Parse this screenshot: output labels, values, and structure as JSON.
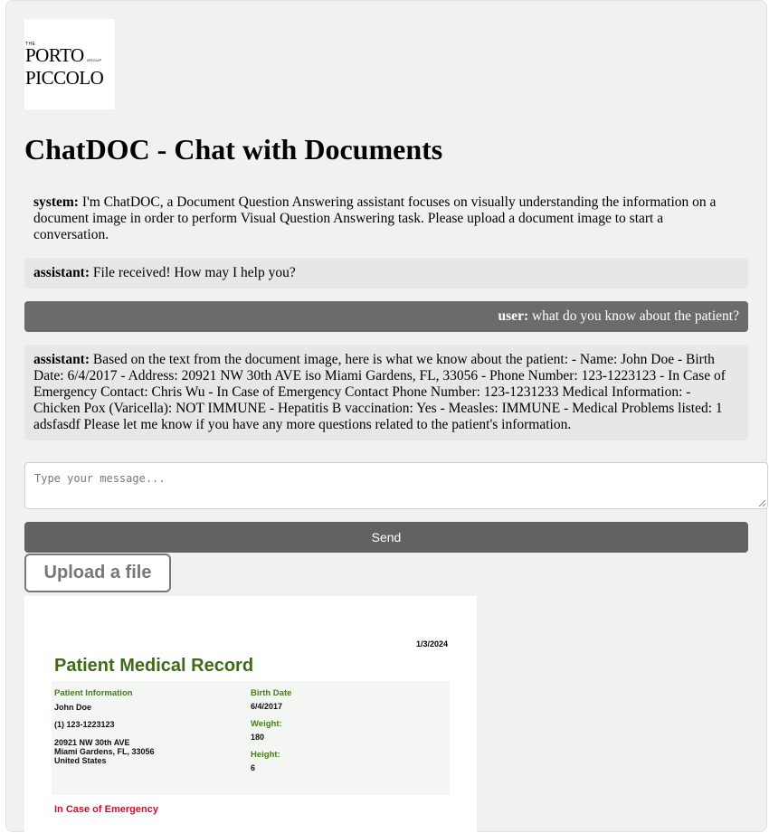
{
  "logo": {
    "small_top": "THE",
    "line1": "PORTO",
    "group": "GROUP",
    "line2": "PICCOLO"
  },
  "title": "ChatDOC - Chat with Documents",
  "messages": [
    {
      "role": "system",
      "speaker": "system:",
      "text": "I'm ChatDOC, a Document Question Answering assistant focuses on visually understanding the information on a document image in order to perform Visual Question Answering task. Please upload a document image to start a conversation."
    },
    {
      "role": "assistant",
      "speaker": "assistant:",
      "text": "File received! How may I help you?"
    },
    {
      "role": "user",
      "speaker": "user:",
      "text": "what do you know about the patient?"
    },
    {
      "role": "assistant",
      "speaker": "assistant:",
      "text": "Based on the text from the document image, here is what we know about the patient: - Name: John Doe - Birth Date: 6/4/2017 - Address: 20921 NW 30th AVE iso Miami Gardens, FL, 33056 - Phone Number: 123-1223123 - In Case of Emergency Contact: Chris Wu - In Case of Emergency Contact Phone Number: 123-1231233 Medical Information: - Chicken Pox (Varicella): NOT IMMUNE - Hepatitis B vaccination: Yes - Measles: IMMUNE - Medical Problems listed: 1 adsfasdf Please let me know if you have any more questions related to the patient's information."
    }
  ],
  "input": {
    "placeholder": "Type your message..."
  },
  "send_label": "Send",
  "upload_label": "Upload a file",
  "document": {
    "date": "1/3/2024",
    "heading": "Patient Medical Record",
    "patient_info_label": "Patient Information",
    "name": "John Doe",
    "phone": "(1) 123-1223123",
    "address_line1": "20921 NW 30th AVE",
    "address_line2": "Miami Gardens, FL, 33056",
    "address_line3": "United States",
    "birth_date_label": "Birth Date",
    "birth_date": "6/4/2017",
    "weight_label": "Weight:",
    "weight": "180",
    "height_label": "Height:",
    "height": "6",
    "emergency_label": "In Case of Emergency"
  }
}
